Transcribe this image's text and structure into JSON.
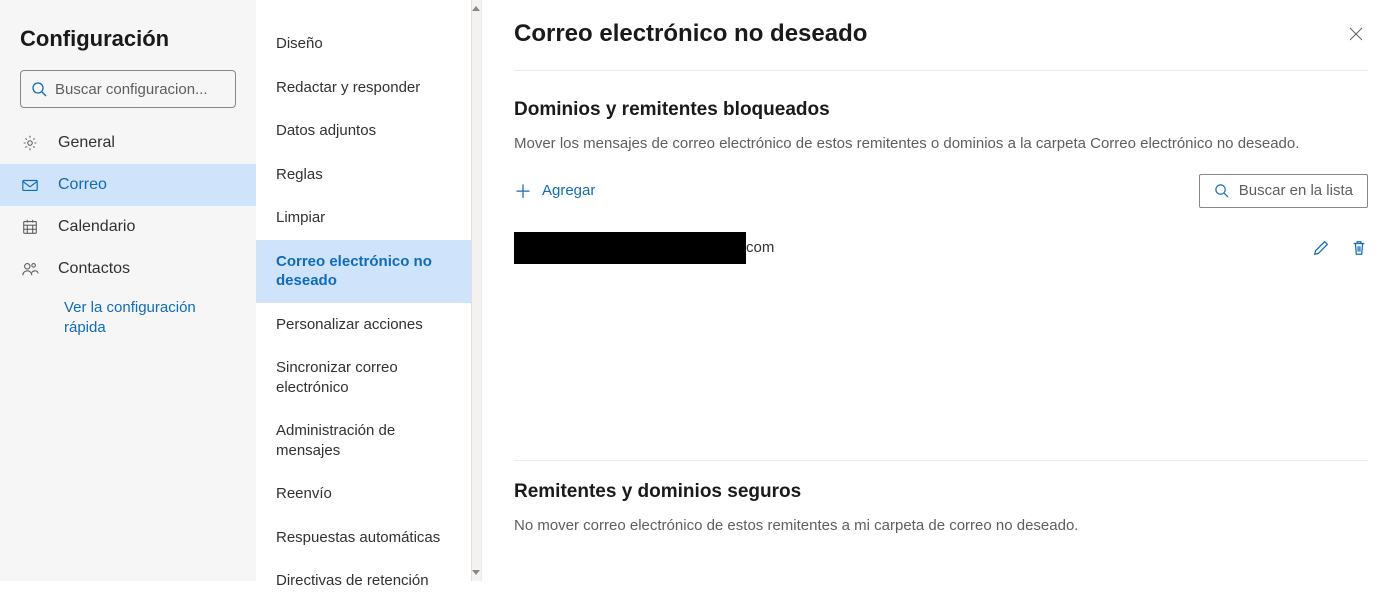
{
  "sidebar": {
    "title": "Configuración",
    "search_placeholder": "Buscar configuracion...",
    "items": [
      {
        "id": "general",
        "label": "General"
      },
      {
        "id": "mail",
        "label": "Correo"
      },
      {
        "id": "calendar",
        "label": "Calendario"
      },
      {
        "id": "contacts",
        "label": "Contactos"
      }
    ],
    "quick_link": "Ver la configuración rápida"
  },
  "mid": {
    "items": [
      "Diseño",
      "Redactar y responder",
      "Datos adjuntos",
      "Reglas",
      "Limpiar",
      "Correo electrónico no deseado",
      "Personalizar acciones",
      "Sincronizar correo electrónico",
      "Administración de mensajes",
      "Reenvío",
      "Respuestas automáticas",
      "Directivas de retención"
    ],
    "active_index": 5
  },
  "main": {
    "title": "Correo electrónico no deseado",
    "blocked": {
      "heading": "Dominios y remitentes bloqueados",
      "description": "Mover los mensajes de correo electrónico de estos remitentes o dominios a la carpeta Correo electrónico no deseado.",
      "add_label": "Agregar",
      "search_label": "Buscar en la lista",
      "entry_suffix": "com"
    },
    "safe": {
      "heading": "Remitentes y dominios seguros",
      "description": "No mover correo electrónico de estos remitentes a mi carpeta de correo no deseado."
    }
  }
}
